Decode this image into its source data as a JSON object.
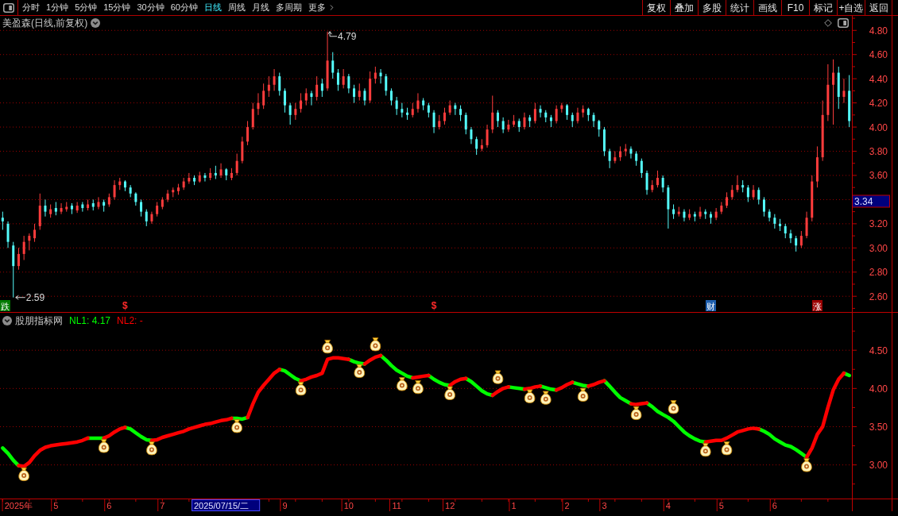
{
  "toolbar": {
    "periods": [
      {
        "label": "分时",
        "selected": false
      },
      {
        "label": "1分钟",
        "selected": false
      },
      {
        "label": "5分钟",
        "selected": false
      },
      {
        "label": "15分钟",
        "selected": false
      },
      {
        "label": "30分钟",
        "selected": false
      },
      {
        "label": "60分钟",
        "selected": false
      },
      {
        "label": "日线",
        "selected": true
      },
      {
        "label": "周线",
        "selected": false
      },
      {
        "label": "月线",
        "selected": false
      },
      {
        "label": "多周期",
        "selected": false
      }
    ],
    "more": {
      "label": "更多"
    },
    "actions": [
      "复权",
      "叠加",
      "多股",
      "统计",
      "画线",
      "F10",
      "标记",
      "+自选",
      "返回"
    ]
  },
  "price_chart": {
    "title": "美盈森(日线,前复权)",
    "extreme_labels": {
      "high": "4.79",
      "low": "2.59"
    },
    "cursor": {
      "price_label": "3.34",
      "date_label": "2025/07/15/二"
    },
    "signals": [
      {
        "label": "跌",
        "kind": "boxed",
        "color": "#007a00"
      },
      {
        "label": "$",
        "kind": "plain",
        "color": "#ff2a2a"
      },
      {
        "label": "$",
        "kind": "plain",
        "color": "#ff2a2a"
      },
      {
        "label": "财",
        "kind": "boxed",
        "color": "#1f5fae"
      },
      {
        "label": "涨",
        "kind": "boxed",
        "color": "#9c0000"
      }
    ],
    "chart_data": [
      {
        "type": "candlestick",
        "ylim": [
          2.47,
          4.92
        ],
        "yticks": [
          {
            "value": 2.6,
            "label": "2.60"
          },
          {
            "value": 2.8,
            "label": "2.80"
          },
          {
            "value": 3.0,
            "label": "3.00"
          },
          {
            "value": 3.2,
            "label": "3.20"
          },
          {
            "value": 3.6,
            "label": "3.60"
          },
          {
            "value": 3.8,
            "label": "3.80"
          },
          {
            "value": 4.0,
            "label": "4.00"
          },
          {
            "value": 4.2,
            "label": "4.20"
          },
          {
            "value": 4.4,
            "label": "4.40"
          },
          {
            "value": 4.6,
            "label": "4.60"
          },
          {
            "value": 4.8,
            "label": "4.80"
          }
        ],
        "grid": true,
        "ohlc": [
          [
            3.25,
            3.3,
            3.15,
            3.22
          ],
          [
            3.2,
            3.22,
            3,
            3.05
          ],
          [
            3.02,
            3.05,
            2.59,
            2.85
          ],
          [
            2.85,
            3,
            2.82,
            2.95
          ],
          [
            2.95,
            3.1,
            2.9,
            3.05
          ],
          [
            3.06,
            3.12,
            2.98,
            3.1
          ],
          [
            3.08,
            3.2,
            3.05,
            3.15
          ],
          [
            3.18,
            3.45,
            3.15,
            3.35
          ],
          [
            3.35,
            3.4,
            3.26,
            3.3
          ],
          [
            3.28,
            3.36,
            3.25,
            3.32
          ],
          [
            3.33,
            3.38,
            3.27,
            3.3
          ],
          [
            3.3,
            3.37,
            3.28,
            3.33
          ],
          [
            3.32,
            3.38,
            3.3,
            3.34
          ],
          [
            3.35,
            3.37,
            3.28,
            3.32
          ],
          [
            3.31,
            3.38,
            3.29,
            3.35
          ],
          [
            3.36,
            3.38,
            3.3,
            3.33
          ],
          [
            3.33,
            3.4,
            3.31,
            3.36
          ],
          [
            3.37,
            3.4,
            3.31,
            3.34
          ],
          [
            3.34,
            3.42,
            3.32,
            3.38
          ],
          [
            3.38,
            3.4,
            3.3,
            3.35
          ],
          [
            3.36,
            3.45,
            3.34,
            3.42
          ],
          [
            3.42,
            3.56,
            3.4,
            3.52
          ],
          [
            3.52,
            3.58,
            3.48,
            3.55
          ],
          [
            3.55,
            3.56,
            3.47,
            3.5
          ],
          [
            3.5,
            3.52,
            3.42,
            3.45
          ],
          [
            3.45,
            3.46,
            3.35,
            3.38
          ],
          [
            3.38,
            3.4,
            3.26,
            3.3
          ],
          [
            3.3,
            3.32,
            3.18,
            3.22
          ],
          [
            3.22,
            3.3,
            3.2,
            3.28
          ],
          [
            3.28,
            3.38,
            3.26,
            3.35
          ],
          [
            3.34,
            3.42,
            3.32,
            3.4
          ],
          [
            3.4,
            3.48,
            3.38,
            3.45
          ],
          [
            3.46,
            3.5,
            3.42,
            3.48
          ],
          [
            3.47,
            3.53,
            3.44,
            3.5
          ],
          [
            3.5,
            3.58,
            3.48,
            3.55
          ],
          [
            3.55,
            3.62,
            3.53,
            3.58
          ],
          [
            3.58,
            3.6,
            3.52,
            3.55
          ],
          [
            3.55,
            3.63,
            3.54,
            3.6
          ],
          [
            3.6,
            3.62,
            3.55,
            3.58
          ],
          [
            3.58,
            3.66,
            3.56,
            3.62
          ],
          [
            3.62,
            3.68,
            3.57,
            3.6
          ],
          [
            3.6,
            3.7,
            3.58,
            3.65
          ],
          [
            3.65,
            3.66,
            3.56,
            3.6
          ],
          [
            3.58,
            3.66,
            3.56,
            3.62
          ],
          [
            3.62,
            3.78,
            3.6,
            3.72
          ],
          [
            3.72,
            3.92,
            3.7,
            3.88
          ],
          [
            3.88,
            4.05,
            3.85,
            4
          ],
          [
            4,
            4.2,
            3.98,
            4.15
          ],
          [
            4.15,
            4.28,
            4.1,
            4.2
          ],
          [
            4.18,
            4.36,
            4.15,
            4.3
          ],
          [
            4.3,
            4.42,
            4.25,
            4.35
          ],
          [
            4.35,
            4.48,
            4.3,
            4.42
          ],
          [
            4.42,
            4.45,
            4.26,
            4.3
          ],
          [
            4.3,
            4.32,
            4.12,
            4.18
          ],
          [
            4.18,
            4.2,
            4.02,
            4.1
          ],
          [
            4.1,
            4.2,
            4.06,
            4.15
          ],
          [
            4.15,
            4.28,
            4.12,
            4.22
          ],
          [
            4.22,
            4.32,
            4.18,
            4.28
          ],
          [
            4.28,
            4.3,
            4.18,
            4.25
          ],
          [
            4.25,
            4.42,
            4.22,
            4.35
          ],
          [
            4.36,
            4.4,
            4.25,
            4.3
          ],
          [
            4.32,
            4.79,
            4.3,
            4.55
          ],
          [
            4.55,
            4.62,
            4.4,
            4.45
          ],
          [
            4.45,
            4.48,
            4.3,
            4.35
          ],
          [
            4.35,
            4.48,
            4.32,
            4.42
          ],
          [
            4.42,
            4.44,
            4.28,
            4.32
          ],
          [
            4.32,
            4.35,
            4.2,
            4.25
          ],
          [
            4.25,
            4.36,
            4.22,
            4.3
          ],
          [
            4.3,
            4.32,
            4.18,
            4.22
          ],
          [
            4.22,
            4.46,
            4.2,
            4.4
          ],
          [
            4.4,
            4.5,
            4.36,
            4.45
          ],
          [
            4.45,
            4.48,
            4.36,
            4.42
          ],
          [
            4.42,
            4.44,
            4.26,
            4.3
          ],
          [
            4.3,
            4.32,
            4.18,
            4.22
          ],
          [
            4.22,
            4.25,
            4.1,
            4.15
          ],
          [
            4.15,
            4.2,
            4.08,
            4.12
          ],
          [
            4.12,
            4.16,
            4.06,
            4.1
          ],
          [
            4.1,
            4.2,
            4.08,
            4.15
          ],
          [
            4.15,
            4.28,
            4.12,
            4.22
          ],
          [
            4.22,
            4.24,
            4.14,
            4.18
          ],
          [
            4.18,
            4.2,
            4.08,
            4.12
          ],
          [
            4.12,
            4.14,
            3.95,
            4
          ],
          [
            4,
            4.1,
            3.98,
            4.05
          ],
          [
            4.05,
            4.16,
            4.02,
            4.12
          ],
          [
            4.12,
            4.22,
            4.1,
            4.18
          ],
          [
            4.18,
            4.2,
            4.1,
            4.15
          ],
          [
            4.15,
            4.18,
            4.05,
            4.1
          ],
          [
            4.1,
            4.12,
            3.94,
            3.98
          ],
          [
            3.98,
            4,
            3.86,
            3.9
          ],
          [
            3.9,
            3.92,
            3.77,
            3.82
          ],
          [
            3.82,
            3.9,
            3.8,
            3.85
          ],
          [
            3.85,
            4.02,
            3.83,
            3.98
          ],
          [
            3.98,
            4.26,
            3.95,
            4.12
          ],
          [
            4.12,
            4.14,
            4,
            4.05
          ],
          [
            4.05,
            4.08,
            3.95,
            3.98
          ],
          [
            3.98,
            4.06,
            3.96,
            4.02
          ],
          [
            4.02,
            4.1,
            4,
            4.05
          ],
          [
            4.05,
            4.07,
            3.96,
            4
          ],
          [
            4,
            4.12,
            3.98,
            4.08
          ],
          [
            4.08,
            4.1,
            4,
            4.05
          ],
          [
            4.05,
            4.2,
            4.03,
            4.15
          ],
          [
            4.15,
            4.18,
            4.08,
            4.12
          ],
          [
            4.12,
            4.14,
            4.04,
            4.08
          ],
          [
            4.08,
            4.1,
            4,
            4.05
          ],
          [
            4.05,
            4.18,
            4.03,
            4.15
          ],
          [
            4.15,
            4.2,
            4.12,
            4.18
          ],
          [
            4.18,
            4.19,
            4.06,
            4.1
          ],
          [
            4.1,
            4.12,
            4,
            4.05
          ],
          [
            4.05,
            4.16,
            4.03,
            4.12
          ],
          [
            4.12,
            4.18,
            4.08,
            4.15
          ],
          [
            4.15,
            4.16,
            4.05,
            4.1
          ],
          [
            4.1,
            4.12,
            4,
            4.05
          ],
          [
            4.05,
            4.06,
            3.92,
            3.98
          ],
          [
            3.98,
            4,
            3.76,
            3.8
          ],
          [
            3.8,
            3.82,
            3.66,
            3.72
          ],
          [
            3.72,
            3.8,
            3.7,
            3.75
          ],
          [
            3.75,
            3.84,
            3.72,
            3.8
          ],
          [
            3.8,
            3.86,
            3.76,
            3.82
          ],
          [
            3.82,
            3.84,
            3.74,
            3.78
          ],
          [
            3.78,
            3.8,
            3.68,
            3.72
          ],
          [
            3.72,
            3.74,
            3.58,
            3.62
          ],
          [
            3.62,
            3.64,
            3.44,
            3.48
          ],
          [
            3.48,
            3.56,
            3.46,
            3.52
          ],
          [
            3.52,
            3.64,
            3.5,
            3.58
          ],
          [
            3.58,
            3.6,
            3.46,
            3.5
          ],
          [
            3.5,
            3.52,
            3.16,
            3.32
          ],
          [
            3.32,
            3.36,
            3.24,
            3.28
          ],
          [
            3.28,
            3.34,
            3.26,
            3.3
          ],
          [
            3.3,
            3.32,
            3.22,
            3.25
          ],
          [
            3.25,
            3.32,
            3.23,
            3.28
          ],
          [
            3.28,
            3.3,
            3.22,
            3.26
          ],
          [
            3.26,
            3.34,
            3.24,
            3.3
          ],
          [
            3.3,
            3.32,
            3.24,
            3.28
          ],
          [
            3.28,
            3.3,
            3.2,
            3.25
          ],
          [
            3.25,
            3.33,
            3.23,
            3.3
          ],
          [
            3.3,
            3.38,
            3.28,
            3.35
          ],
          [
            3.35,
            3.46,
            3.33,
            3.42
          ],
          [
            3.42,
            3.52,
            3.4,
            3.48
          ],
          [
            3.48,
            3.6,
            3.46,
            3.52
          ],
          [
            3.52,
            3.56,
            3.46,
            3.5
          ],
          [
            3.5,
            3.52,
            3.38,
            3.42
          ],
          [
            3.42,
            3.52,
            3.4,
            3.48
          ],
          [
            3.48,
            3.5,
            3.36,
            3.4
          ],
          [
            3.4,
            3.42,
            3.26,
            3.3
          ],
          [
            3.3,
            3.32,
            3.22,
            3.25
          ],
          [
            3.25,
            3.28,
            3.16,
            3.2
          ],
          [
            3.2,
            3.24,
            3.14,
            3.18
          ],
          [
            3.18,
            3.2,
            3.08,
            3.12
          ],
          [
            3.12,
            3.15,
            3.04,
            3.08
          ],
          [
            3.08,
            3.1,
            2.97,
            3.02
          ],
          [
            3.02,
            3.14,
            3,
            3.1
          ],
          [
            3.1,
            3.3,
            3.08,
            3.25
          ],
          [
            3.25,
            3.6,
            3.22,
            3.55
          ],
          [
            3.55,
            3.84,
            3.5,
            3.75
          ],
          [
            3.75,
            4.22,
            3.72,
            4.1
          ],
          [
            4.1,
            4.52,
            4.05,
            4.35
          ],
          [
            4.35,
            4.56,
            4.02,
            4.45
          ],
          [
            4.45,
            4.5,
            4.15,
            4.25
          ],
          [
            4.25,
            4.4,
            4.2,
            4.3
          ],
          [
            4.3,
            4.43,
            4,
            4.05
          ]
        ]
      }
    ]
  },
  "indicator": {
    "title": "股朋指标网",
    "legend": [
      {
        "label": "NL1: 4.17",
        "color": "#00ff00"
      },
      {
        "label": "NL2: -",
        "color": "#ff0000"
      }
    ],
    "chart_data": [
      {
        "type": "line",
        "ylim": [
          2.56,
          4.99
        ],
        "yticks": [
          {
            "value": 3.0,
            "label": "3.00"
          },
          {
            "value": 3.5,
            "label": "3.50"
          },
          {
            "value": 4.0,
            "label": "4.00"
          },
          {
            "value": 4.5,
            "label": "4.50"
          }
        ],
        "grid": true,
        "categories": [
          null,
          null,
          null,
          "2025年",
          null,
          null,
          null,
          null,
          null,
          null,
          "5",
          null,
          null,
          null,
          null,
          null,
          null,
          null,
          null,
          null,
          "6",
          null,
          null,
          null,
          null,
          null,
          null,
          null,
          null,
          null,
          "7",
          null,
          null,
          null,
          null,
          null,
          null,
          null,
          null,
          null,
          null,
          null,
          null,
          null,
          null,
          null,
          null,
          null,
          null,
          null,
          null,
          null,
          null,
          "9",
          null,
          null,
          null,
          null,
          null,
          null,
          null,
          null,
          null,
          null,
          null,
          "10",
          null,
          null,
          null,
          null,
          null,
          null,
          null,
          null,
          "11",
          null,
          null,
          null,
          null,
          null,
          null,
          null,
          null,
          null,
          "12",
          null,
          null,
          null,
          null,
          null,
          null,
          null,
          null,
          null,
          null,
          null,
          "1",
          null,
          null,
          null,
          null,
          null,
          null,
          null,
          null,
          null,
          "2",
          null,
          null,
          null,
          null,
          null,
          null,
          "3",
          null,
          null,
          null,
          null,
          null,
          null,
          null,
          null,
          null,
          null,
          null,
          "4",
          null,
          null,
          null,
          null,
          null,
          null,
          null,
          null,
          null,
          "5",
          null,
          null,
          null,
          null,
          null,
          null,
          null,
          null,
          null,
          "6",
          null,
          null,
          null,
          null,
          null,
          null,
          null,
          null,
          null,
          null,
          null,
          null,
          null,
          null
        ],
        "series": [
          {
            "color": "#00ff00",
            "values": [
              3.22,
              3.15,
              3.06,
              2.99,
              null,
              null,
              null,
              null,
              null,
              null,
              null,
              null,
              null,
              null,
              null,
              null,
              3.35,
              3.35,
              3.35,
              3.35,
              null,
              null,
              null,
              3.49,
              3.47,
              3.42,
              3.37,
              3.33,
              3.32,
              null,
              null,
              null,
              null,
              null,
              null,
              null,
              null,
              null,
              null,
              null,
              null,
              null,
              null,
              3.61,
              3.61,
              3.6,
              3.62,
              null,
              null,
              null,
              null,
              null,
              4.25,
              4.23,
              4.18,
              4.13,
              4.1,
              null,
              null,
              null,
              null,
              null,
              null,
              null,
              null,
              4.38,
              4.35,
              4.33,
              4.32,
              null,
              null,
              4.43,
              4.37,
              4.3,
              4.24,
              4.2,
              4.16,
              4.14,
              null,
              null,
              4.17,
              4.12,
              4.08,
              4.05,
              4.04,
              null,
              null,
              4.13,
              4.09,
              4.03,
              3.97,
              3.93,
              3.91,
              null,
              null,
              4.02,
              4.01,
              4,
              3.99,
              null,
              null,
              4.03,
              4.01,
              3.99,
              3.98,
              null,
              null,
              4.08,
              4.06,
              4.04,
              4.03,
              null,
              null,
              4.1,
              4.03,
              3.95,
              3.88,
              3.84,
              3.8,
              null,
              null,
              3.81,
              3.76,
              3.7,
              3.66,
              3.62,
              3.57,
              3.5,
              3.43,
              3.38,
              3.34,
              3.31,
              3.3,
              null,
              null,
              null,
              null,
              null,
              null,
              null,
              null,
              null,
              3.47,
              3.44,
              3.4,
              3.34,
              3.3,
              3.26,
              3.24,
              3.2,
              3.15,
              3.1,
              null,
              null,
              null,
              null,
              null,
              null,
              4.2,
              4.17
            ]
          },
          {
            "color": "#ff0000",
            "values": [
              null,
              null,
              null,
              2.99,
              2.98,
              3.03,
              3.12,
              3.19,
              3.23,
              3.25,
              3.26,
              3.27,
              3.28,
              3.29,
              3.3,
              3.32,
              3.35,
              null,
              null,
              3.35,
              3.38,
              3.43,
              3.47,
              3.49,
              null,
              null,
              null,
              null,
              3.32,
              3.33,
              3.36,
              3.38,
              3.4,
              3.42,
              3.44,
              3.47,
              3.49,
              3.51,
              3.53,
              3.54,
              3.56,
              3.58,
              3.59,
              3.61,
              null,
              null,
              3.62,
              3.8,
              3.95,
              4.04,
              4.12,
              4.2,
              4.25,
              null,
              null,
              null,
              4.1,
              4.12,
              4.15,
              4.17,
              4.2,
              4.38,
              4.4,
              4.4,
              4.39,
              4.38,
              null,
              null,
              4.32,
              4.37,
              4.41,
              4.43,
              null,
              null,
              null,
              null,
              null,
              4.14,
              4.15,
              4.16,
              4.17,
              null,
              null,
              null,
              4.04,
              4.09,
              4.12,
              4.13,
              null,
              null,
              null,
              null,
              3.91,
              3.96,
              4,
              4.02,
              null,
              null,
              3.99,
              4,
              4.02,
              4.03,
              null,
              null,
              3.98,
              4.01,
              4.05,
              4.08,
              null,
              null,
              4.03,
              4.05,
              4.08,
              4.1,
              null,
              null,
              null,
              null,
              3.8,
              3.79,
              3.8,
              3.81,
              null,
              null,
              null,
              null,
              null,
              null,
              null,
              null,
              null,
              null,
              3.3,
              3.31,
              3.32,
              3.32,
              3.35,
              3.39,
              3.43,
              3.45,
              3.47,
              3.48,
              3.47,
              null,
              null,
              null,
              null,
              null,
              null,
              null,
              null,
              3.1,
              3.22,
              3.4,
              3.5,
              3.75,
              3.98,
              4.12,
              4.2,
              null
            ]
          },
          {
            "type": "scatter",
            "color": "#fff2b8",
            "values": [
              null,
              null,
              null,
              null,
              2.86,
              null,
              null,
              null,
              null,
              null,
              null,
              null,
              null,
              null,
              null,
              null,
              null,
              null,
              null,
              3.23,
              null,
              null,
              null,
              null,
              null,
              null,
              null,
              null,
              3.2,
              null,
              null,
              null,
              null,
              null,
              null,
              null,
              null,
              null,
              null,
              null,
              null,
              null,
              null,
              null,
              3.49,
              null,
              null,
              null,
              null,
              null,
              null,
              null,
              null,
              null,
              null,
              null,
              3.98,
              null,
              null,
              null,
              null,
              4.53,
              null,
              null,
              null,
              null,
              null,
              4.21,
              null,
              null,
              4.56,
              null,
              null,
              null,
              null,
              4.04,
              null,
              null,
              4,
              null,
              null,
              null,
              null,
              null,
              3.92,
              null,
              null,
              null,
              null,
              null,
              null,
              null,
              null,
              4.13,
              null,
              null,
              null,
              null,
              null,
              3.88,
              null,
              null,
              3.86,
              null,
              null,
              null,
              null,
              null,
              null,
              3.9,
              null,
              null,
              null,
              null,
              null,
              null,
              null,
              null,
              null,
              3.66,
              null,
              null,
              null,
              null,
              null,
              null,
              3.74,
              null,
              null,
              null,
              null,
              null,
              3.18,
              null,
              null,
              null,
              3.2,
              null,
              null,
              null,
              null,
              null,
              null,
              null,
              null,
              null,
              null,
              null,
              null,
              null,
              null,
              2.98,
              null,
              null,
              null,
              null,
              null,
              null,
              null,
              null
            ]
          }
        ]
      }
    ]
  }
}
